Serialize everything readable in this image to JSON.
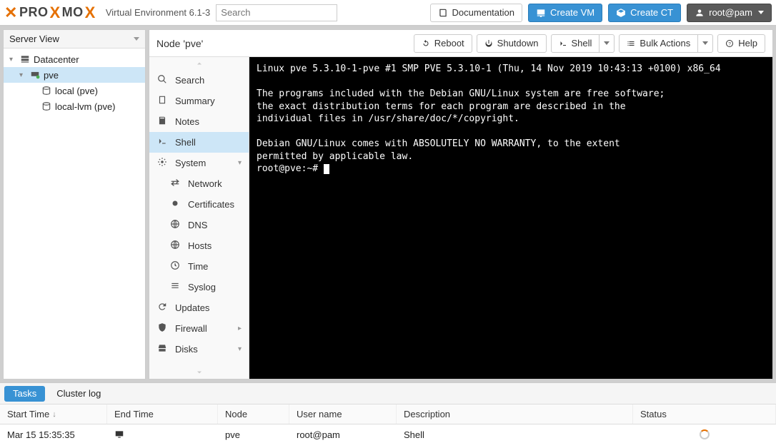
{
  "header": {
    "product": "PROXMOX",
    "subtitle": "Virtual Environment 6.1-3",
    "search_placeholder": "Search",
    "doc_label": "Documentation",
    "create_vm_label": "Create VM",
    "create_ct_label": "Create CT",
    "user_label": "root@pam"
  },
  "leftpane": {
    "view_label": "Server View",
    "nodes": {
      "datacenter": "Datacenter",
      "pve": "pve",
      "local": "local (pve)",
      "local_lvm": "local-lvm (pve)"
    }
  },
  "content": {
    "title": "Node 'pve'",
    "buttons": {
      "reboot": "Reboot",
      "shutdown": "Shutdown",
      "shell": "Shell",
      "bulk": "Bulk Actions",
      "help": "Help"
    },
    "subnav": {
      "search": "Search",
      "summary": "Summary",
      "notes": "Notes",
      "shell": "Shell",
      "system": "System",
      "network": "Network",
      "certificates": "Certificates",
      "dns": "DNS",
      "hosts": "Hosts",
      "time": "Time",
      "syslog": "Syslog",
      "updates": "Updates",
      "firewall": "Firewall",
      "disks": "Disks"
    },
    "terminal": {
      "line1": "Linux pve 5.3.10-1-pve #1 SMP PVE 5.3.10-1 (Thu, 14 Nov 2019 10:43:13 +0100) x86_64",
      "line2": "The programs included with the Debian GNU/Linux system are free software;",
      "line3": "the exact distribution terms for each program are described in the",
      "line4": "individual files in /usr/share/doc/*/copyright.",
      "line5": "Debian GNU/Linux comes with ABSOLUTELY NO WARRANTY, to the extent",
      "line6": "permitted by applicable law.",
      "prompt": "root@pve:~# "
    }
  },
  "bottom": {
    "tabs": {
      "tasks": "Tasks",
      "cluster": "Cluster log"
    },
    "cols": {
      "start": "Start Time",
      "end": "End Time",
      "node": "Node",
      "user": "User name",
      "desc": "Description",
      "status": "Status"
    },
    "row": {
      "start": "Mar 15 15:35:35",
      "node": "pve",
      "user": "root@pam",
      "desc": "Shell"
    }
  }
}
